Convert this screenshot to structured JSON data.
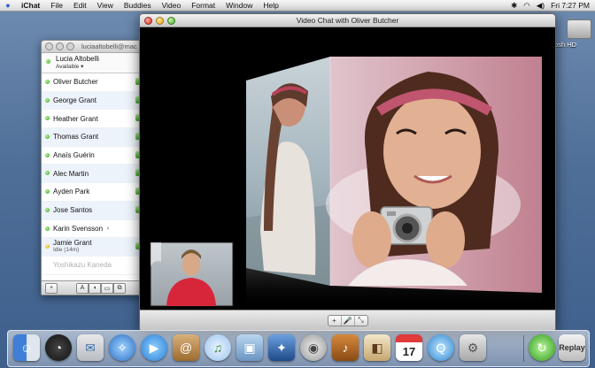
{
  "menubar": {
    "app_name": "iChat",
    "menus": [
      "File",
      "Edit",
      "View",
      "Buddies",
      "Video",
      "Format",
      "Window",
      "Help"
    ],
    "clock": "Fri 7:27 PM",
    "status_icons": [
      "bluetooth-icon",
      "wifi-icon",
      "volume-icon"
    ]
  },
  "desktop": {
    "hd_label": "tosh HD"
  },
  "buddy_list": {
    "title": "luciaaltobelli@mac",
    "me": {
      "name": "Lucia Altobelli",
      "status": "Available ▾"
    },
    "buddies": [
      {
        "name": "Oliver Butcher",
        "state": "available",
        "camera": true
      },
      {
        "name": "George Grant",
        "state": "available",
        "camera": true
      },
      {
        "name": "Heather Grant",
        "state": "available",
        "camera": true
      },
      {
        "name": "Thomas Grant",
        "state": "available",
        "camera": true
      },
      {
        "name": "Anaïs Guérin",
        "state": "available",
        "camera": true
      },
      {
        "name": "Alec Martin",
        "state": "available",
        "camera": true
      },
      {
        "name": "Ayden Park",
        "state": "available",
        "camera": true
      },
      {
        "name": "Jose Santos",
        "state": "available",
        "camera": true
      },
      {
        "name": "Karin Svensson",
        "state": "available",
        "camera": false
      },
      {
        "name": "Jamie Grant",
        "state": "idle",
        "idle_text": "Idle (14m)",
        "camera": true
      },
      {
        "name": "Yoshikazu Kaneda",
        "state": "offline",
        "camera": false
      }
    ],
    "bottom_buttons": {
      "add": "+",
      "text": "A"
    }
  },
  "video_chat": {
    "title": "Video Chat with Oliver Butcher",
    "controls": {
      "add": "+",
      "mute": "🎤",
      "fullscreen": "⤡"
    }
  },
  "dock": {
    "items": [
      "Finder",
      "Dashboard",
      "Mail",
      "Safari",
      "iChat",
      "Address Book",
      "iTunes",
      "iPhoto",
      "iMovie",
      "DVD Player",
      "GarageBand",
      "Preview",
      "iCal",
      "QuickTime Player",
      "System Preferences",
      "Replay",
      "Trash"
    ],
    "ical_date": "17",
    "replay_label": "Replay"
  },
  "colors": {
    "available": "#33a31a",
    "idle": "#d8a800",
    "desktop": "#4f6f98"
  }
}
